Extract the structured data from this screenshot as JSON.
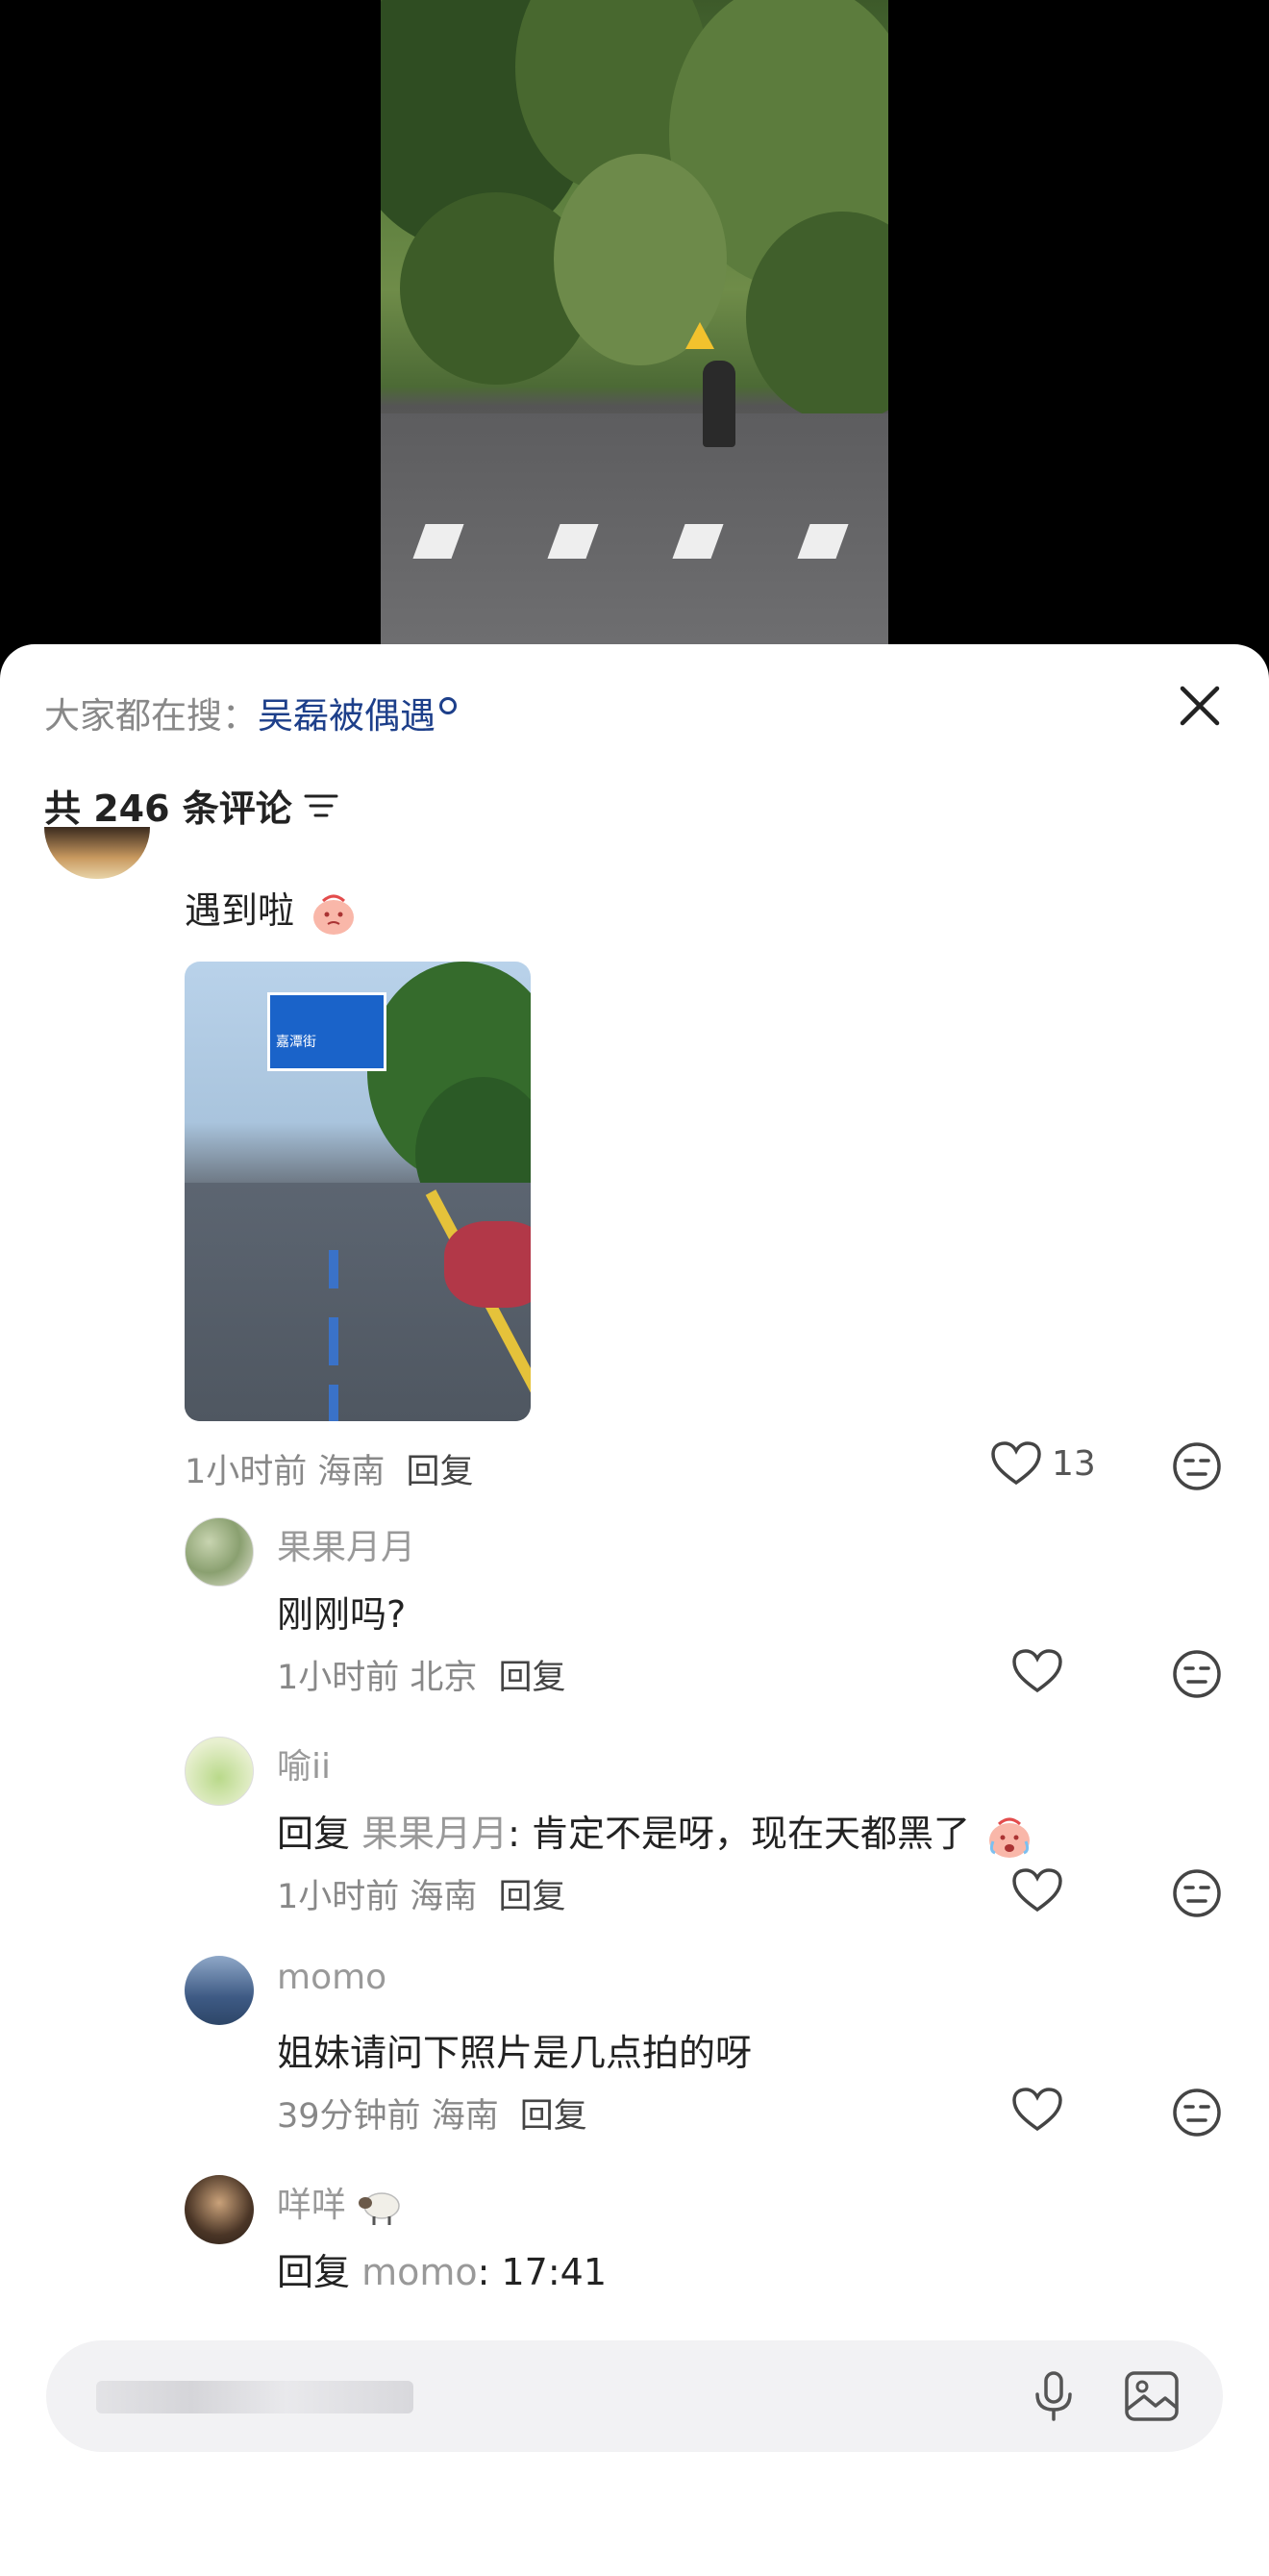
{
  "search_hint": {
    "prefix": "大家都在搜：",
    "keyword": "吴磊被偶遇"
  },
  "comment_count": "共 246 条评论",
  "main_comment": {
    "text": "遇到啦",
    "time": "1小时前",
    "location": "海南",
    "reply_label": "回复",
    "likes": "13"
  },
  "replies": [
    {
      "username": "果果月月",
      "text": "刚刚吗?",
      "reply_to": "",
      "time": "1小时前",
      "location": "北京",
      "reply_label": "回复"
    },
    {
      "username": "喻ii",
      "text": ": 肯定不是呀，现在天都黑了",
      "reply_prefix": "回复 ",
      "reply_to": "果果月月",
      "time": "1小时前",
      "location": "海南",
      "reply_label": "回复"
    },
    {
      "username": "momo",
      "text": "姐妹请问下照片是几点拍的呀",
      "reply_to": "",
      "time": "39分钟前",
      "location": "海南",
      "reply_label": "回复"
    },
    {
      "username": "咩咩",
      "text": ": 17:41",
      "reply_prefix": "回复 ",
      "reply_to": "momo"
    }
  ],
  "photo_sign": "嘉潭街",
  "input": {
    "placeholder": ""
  },
  "colors": {
    "accent": "#1d3f8a",
    "sheet_bg": "#ffffff",
    "page_bg": "#000000"
  },
  "icons": [
    "close-icon",
    "filter-icon",
    "heart-icon",
    "emoji-face-icon",
    "microphone-icon",
    "image-icon"
  ]
}
